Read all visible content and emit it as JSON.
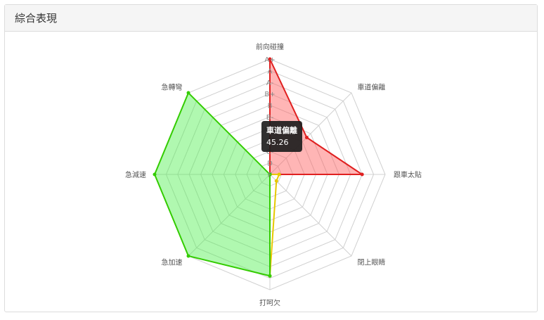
{
  "panel": {
    "title": "綜合表現"
  },
  "chart_data": {
    "type": "radar",
    "axes": [
      "前向碰撞",
      "車道偏離",
      "跟車太貼",
      "閉上眼睛",
      "打呵欠",
      "急加速",
      "急減速",
      "急轉彎"
    ],
    "grade_labels": [
      "A+",
      "A",
      "A-",
      "B+",
      "B",
      "B-",
      "C+",
      "C",
      "C-",
      "D",
      "F"
    ],
    "max": 100,
    "rings": 10,
    "series": [
      {
        "color": "#e02020",
        "fill": "rgba(255,90,90,0.45)",
        "values": [
          100,
          45.26,
          80,
          0,
          0,
          0,
          0,
          0
        ]
      },
      {
        "color": "#e6c800",
        "fill": "rgba(0,0,0,0)",
        "values": [
          0,
          0,
          8,
          8,
          88,
          0,
          0,
          0
        ]
      },
      {
        "color": "#33cc00",
        "fill": "rgba(80,240,80,0.45)",
        "values": [
          0,
          0,
          0,
          0,
          88,
          100,
          100,
          100
        ]
      }
    ],
    "tooltip": {
      "title": "車道偏離",
      "value": "45.26"
    }
  },
  "colors": {
    "grid": "#d0d0d0",
    "axis_label": "#555555",
    "header_bg": "#f5f5f5"
  }
}
